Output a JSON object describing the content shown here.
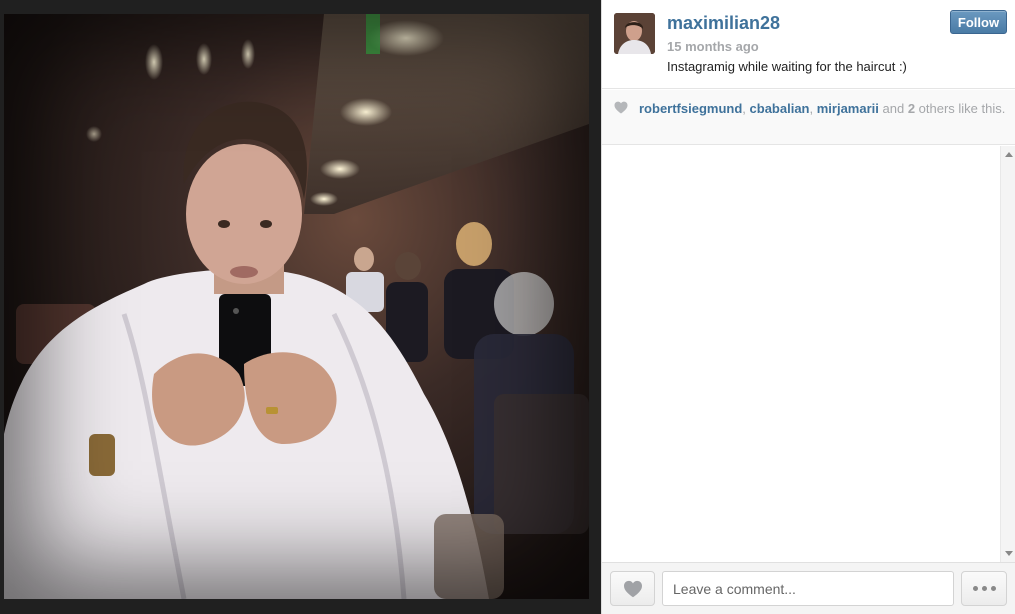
{
  "post": {
    "username": "maximilian28",
    "timestamp": "15 months ago",
    "caption": "Instagramig while waiting for the haircut :)",
    "follow_label": "Follow"
  },
  "likes": {
    "users": [
      "robertfsiegmund",
      "cbabalian",
      "mirjamarii"
    ],
    "sep1": ", ",
    "sep2": ", ",
    "and_text": " and ",
    "others_count": "2",
    "others_text": " others like this."
  },
  "comment_box": {
    "placeholder": "Leave a comment..."
  },
  "icons": {
    "like": "heart-icon",
    "more": "ellipsis-icon"
  },
  "colors": {
    "link": "#3f729b",
    "follow_bg": "#4a7ba5",
    "muted": "#a5a7aa"
  }
}
